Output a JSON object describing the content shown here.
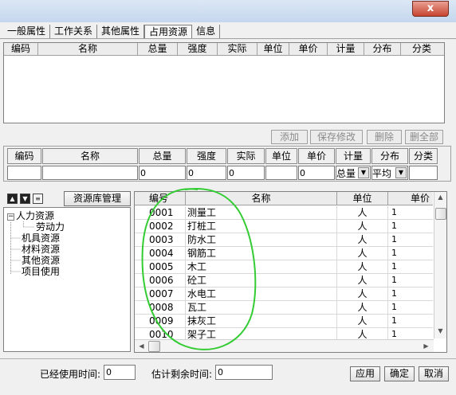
{
  "window": {
    "close_label": "x"
  },
  "tabs": [
    {
      "label": "一般属性",
      "active": false
    },
    {
      "label": "工作关系",
      "active": false
    },
    {
      "label": "其他属性",
      "active": false
    },
    {
      "label": "占用资源",
      "active": true
    },
    {
      "label": "信息",
      "active": false
    }
  ],
  "assigned_table": {
    "columns": [
      "编码",
      "名称",
      "总量",
      "强度",
      "实际",
      "单位",
      "单价",
      "计量",
      "分布",
      "分类"
    ]
  },
  "actions": {
    "add": "添加",
    "save": "保存修改",
    "delete": "删除",
    "delete_all": "删全部"
  },
  "editor": {
    "columns": [
      "编码",
      "名称",
      "总量",
      "强度",
      "实际",
      "单位",
      "单价",
      "计量",
      "分布",
      "分类"
    ],
    "values": {
      "code": "",
      "name": "",
      "total": "0",
      "intensity": "0",
      "actual": "0",
      "unit": "",
      "price": "0",
      "metering": "总量",
      "distribution": "平均",
      "category": ""
    }
  },
  "library_button": "资源库管理",
  "tree": {
    "human": "人力资源",
    "labor": "劳动力",
    "machinery": "机具资源",
    "material": "材料资源",
    "other": "其他资源",
    "project_use": "项目使用"
  },
  "resource_grid": {
    "columns": [
      "编号",
      "名称",
      "单位",
      "单价"
    ],
    "rows": [
      {
        "code": "0001",
        "name": "测量工",
        "unit": "人",
        "price": "1"
      },
      {
        "code": "0002",
        "name": "打桩工",
        "unit": "人",
        "price": "1"
      },
      {
        "code": "0003",
        "name": "防水工",
        "unit": "人",
        "price": "1"
      },
      {
        "code": "0004",
        "name": "钢筋工",
        "unit": "人",
        "price": "1"
      },
      {
        "code": "0005",
        "name": "木工",
        "unit": "人",
        "price": "1"
      },
      {
        "code": "0006",
        "name": "砼工",
        "unit": "人",
        "price": "1"
      },
      {
        "code": "0007",
        "name": "水电工",
        "unit": "人",
        "price": "1"
      },
      {
        "code": "0008",
        "name": "瓦工",
        "unit": "人",
        "price": "1"
      },
      {
        "code": "0009",
        "name": "抹灰工",
        "unit": "人",
        "price": "1"
      },
      {
        "code": "0010",
        "name": "架子工",
        "unit": "人",
        "price": "1"
      }
    ]
  },
  "footer": {
    "used_time_label": "已经使用时间:",
    "used_time_value": "0",
    "remaining_label": "估计剩余时间:",
    "remaining_value": "0",
    "apply": "应用",
    "ok": "确定",
    "cancel": "取消"
  },
  "annotation_color": "#33cc33"
}
